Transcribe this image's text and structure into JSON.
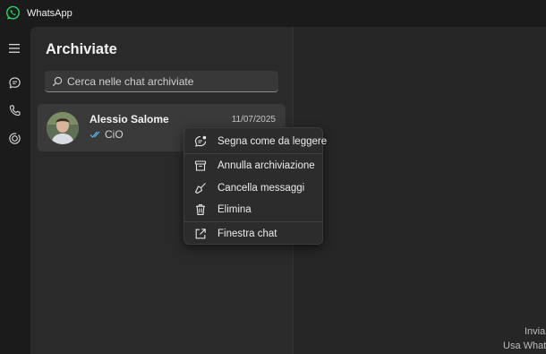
{
  "window": {
    "title": "WhatsApp"
  },
  "rail": {
    "icons": [
      "menu-icon",
      "chat-icon",
      "phone-icon",
      "status-icon"
    ]
  },
  "archived": {
    "title": "Archiviate",
    "search": {
      "placeholder": "Cerca nelle chat archiviate",
      "value": ""
    },
    "chats": [
      {
        "name": "Alessio Salome",
        "date": "11/07/2025",
        "last_message": "CiO",
        "read_status": "read"
      }
    ]
  },
  "context_menu": {
    "items": [
      {
        "label": "Segna come da leggere",
        "icon": "mark-unread-icon"
      },
      {
        "label": "Annulla archiviazione",
        "icon": "unarchive-icon"
      },
      {
        "label": "Cancella messaggi",
        "icon": "broom-icon"
      },
      {
        "label": "Elimina",
        "icon": "trash-icon"
      },
      {
        "label": "Finestra chat",
        "icon": "open-window-icon"
      }
    ]
  },
  "chat_area": {
    "footer_line1": "Invia",
    "footer_line2": "Usa Whats"
  },
  "colors": {
    "brand": "#25d366",
    "read_ticks": "#53bdeb"
  }
}
